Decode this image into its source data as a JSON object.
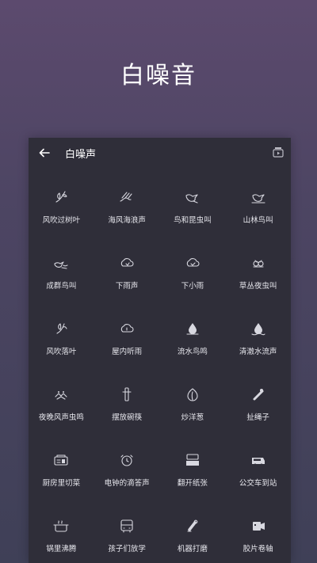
{
  "hero": {
    "title": "白噪音"
  },
  "app": {
    "title": "白噪声"
  },
  "sounds": [
    {
      "label": "风吹过树叶",
      "icon": "leaf-icon"
    },
    {
      "label": "海风海浪声",
      "icon": "wave-icon"
    },
    {
      "label": "鸟和昆虫叫",
      "icon": "bird-icon"
    },
    {
      "label": "山林鸟叫",
      "icon": "mountain-bird-icon"
    },
    {
      "label": "成群鸟叫",
      "icon": "flock-icon"
    },
    {
      "label": "下雨声",
      "icon": "rain-cloud-icon"
    },
    {
      "label": "下小雨",
      "icon": "light-rain-icon"
    },
    {
      "label": "草丛夜虫叫",
      "icon": "insect-icon"
    },
    {
      "label": "风吹落叶",
      "icon": "falling-leaf-icon"
    },
    {
      "label": "屋内听雨",
      "icon": "indoor-rain-icon"
    },
    {
      "label": "流水鸟鸣",
      "icon": "water-drop-icon"
    },
    {
      "label": "清澈水流声",
      "icon": "stream-icon"
    },
    {
      "label": "夜晚风声虫鸣",
      "icon": "night-bug-icon"
    },
    {
      "label": "摆放碗筷",
      "icon": "chopsticks-icon"
    },
    {
      "label": "炒洋葱",
      "icon": "onion-icon"
    },
    {
      "label": "扯绳子",
      "icon": "rope-icon"
    },
    {
      "label": "厨房里切菜",
      "icon": "kitchen-icon"
    },
    {
      "label": "电钟的滴答声",
      "icon": "clock-icon"
    },
    {
      "label": "翻开纸张",
      "icon": "paper-icon"
    },
    {
      "label": "公交车到站",
      "icon": "bus-icon"
    },
    {
      "label": "锅里沸腾",
      "icon": "pot-icon"
    },
    {
      "label": "孩子们放学",
      "icon": "school-bus-icon"
    },
    {
      "label": "机器打磨",
      "icon": "machine-icon"
    },
    {
      "label": "胶片卷轴",
      "icon": "film-icon"
    }
  ]
}
